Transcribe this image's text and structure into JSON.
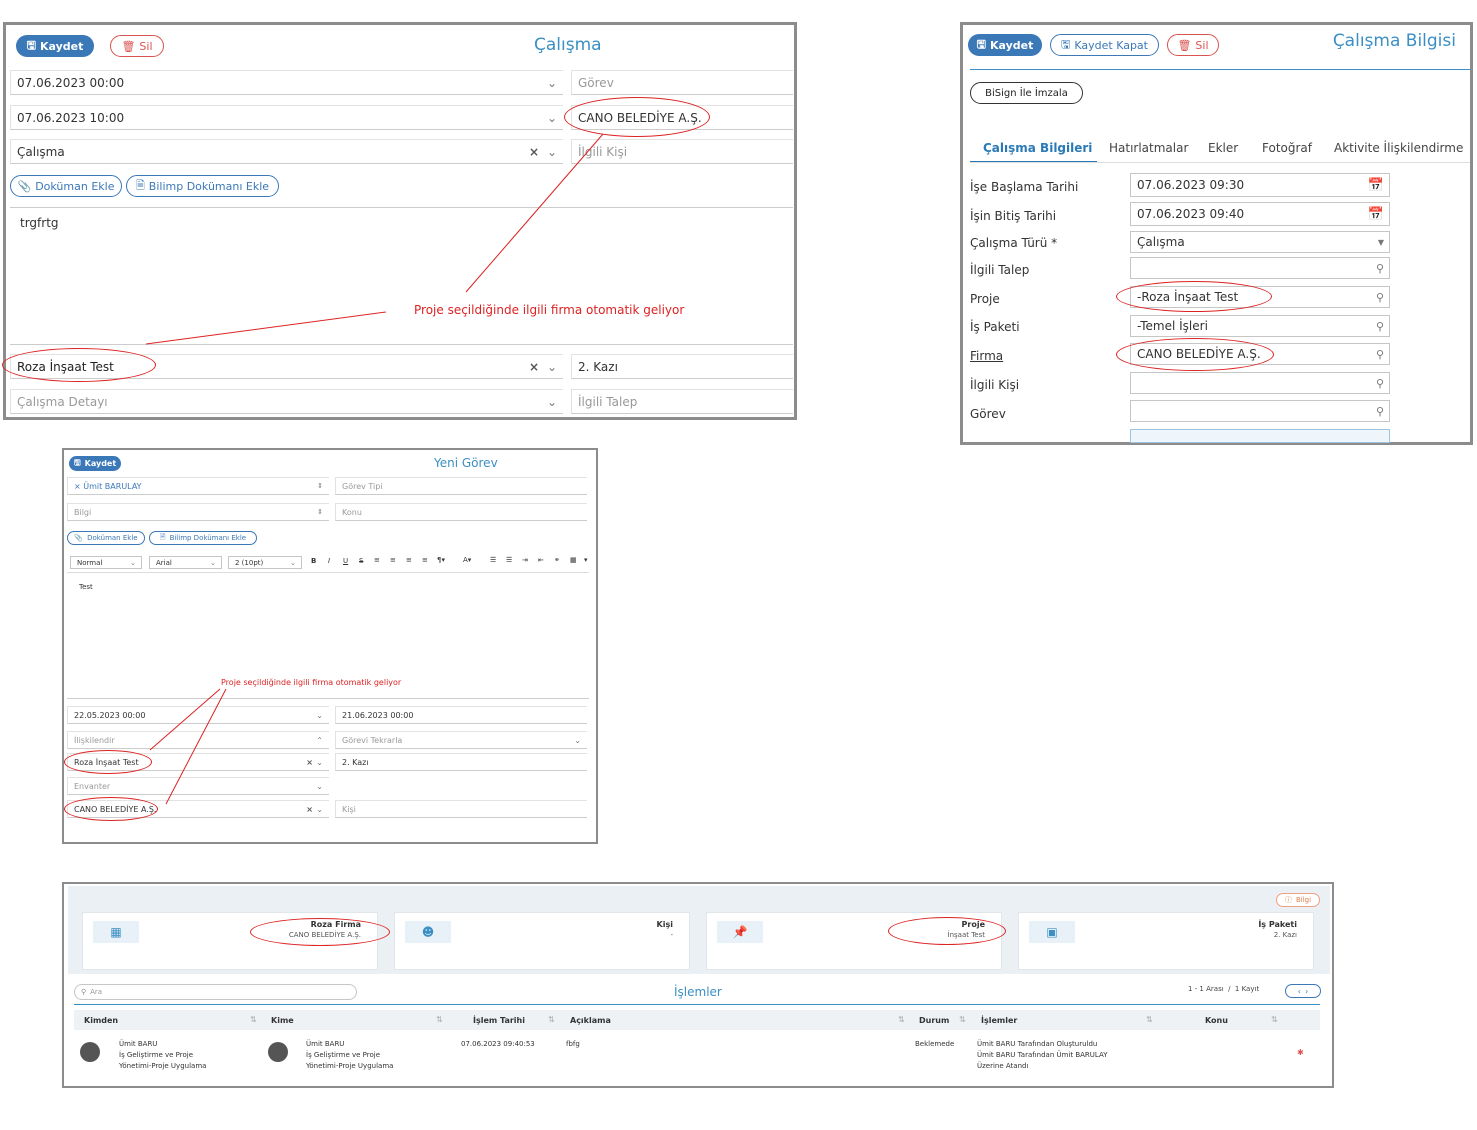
{
  "panel1": {
    "title": "Çalışma",
    "save": "Kaydet",
    "delete": "Sil",
    "start": "07.06.2023 00:00",
    "end": "07.06.2023 10:00",
    "type": "Çalışma",
    "gorev_ph": "Görev",
    "firm": "CANO BELEDİYE A.Ş.",
    "ilgili_kisi_ph": "İlgili Kişi",
    "doc_add": "Doküman Ekle",
    "bilimp_doc_add": "Bilimp Dokümanı Ekle",
    "body_text": "trgfrtg",
    "annotation": "Proje seçildiğinde ilgili firma otomatik geliyor",
    "project": "Roza İnşaat Test",
    "work_package": "2. Kazı",
    "detail_ph": "Çalışma Detayı",
    "talep_ph": "İlgili Talep"
  },
  "panel2": {
    "title": "Çalışma Bilgisi",
    "save": "Kaydet",
    "save_close": "Kaydet Kapat",
    "delete": "Sil",
    "bisign": "BiSign İle İmzala",
    "tabs": [
      "Çalışma Bilgileri",
      "Hatırlatmalar",
      "Ekler",
      "Fotoğraf",
      "Aktivite İlişkilendirme"
    ],
    "rows": [
      {
        "label": "İşe Başlama Tarihi",
        "value": "07.06.2023 09:30"
      },
      {
        "label": "İşin Bitiş Tarihi",
        "value": "07.06.2023 09:40"
      },
      {
        "label": "Çalışma Türü *",
        "value": "Çalışma"
      },
      {
        "label": "İlgili Talep",
        "value": ""
      },
      {
        "label": "Proje",
        "value": "-Roza İnşaat Test"
      },
      {
        "label": "İş Paketi",
        "value": "-Temel İşleri"
      },
      {
        "label": "Firma",
        "value": "CANO BELEDİYE A.Ş."
      },
      {
        "label": "İlgili Kişi",
        "value": ""
      },
      {
        "label": "Görev",
        "value": ""
      }
    ]
  },
  "panel3": {
    "title": "Yeni Görev",
    "save": "Kaydet",
    "assignee": "Ümit BARULAY",
    "gorev_tipi_ph": "Görev Tipi",
    "bilgi_ph": "Bilgi",
    "konu_ph": "Konu",
    "doc_add": "Doküman Ekle",
    "bilimp_doc_add": "Bilimp Dokümanı Ekle",
    "style_sel": "Normal",
    "font_sel": "Arial",
    "size_sel": "2 (10pt)",
    "body_text": "Test",
    "annotation": "Proje seçildiğinde ilgili firma otomatik geliyor",
    "start": "22.05.2023 00:00",
    "end": "21.06.2023 00:00",
    "relate_ph": "İlişkilendir",
    "repeat_ph": "Görevi Tekrarla",
    "project": "Roza İnşaat Test",
    "work_package": "2. Kazı",
    "envanter_ph": "Envanter",
    "firm": "CANO BELEDİYE A.Ş.",
    "kisi_ph": "Kişi"
  },
  "panel4": {
    "info_btn": "Bilgi",
    "cards": [
      {
        "title": "Roza Firma",
        "value": "CANO BELEDİYE A.Ş.",
        "icon": "building-icon"
      },
      {
        "title": "Kişi",
        "value": "-",
        "icon": "user-icon"
      },
      {
        "title": "Proje",
        "value": "İnşaat Test",
        "icon": "pin-icon"
      },
      {
        "title": "İş Paketi",
        "value": "2. Kazı",
        "icon": "box-icon"
      }
    ],
    "search_ph": "Ara",
    "section_title": "İşlemler",
    "paging": "1 - 1 Arası  /  1 Kayıt",
    "columns": [
      "Kimden",
      "Kime",
      "İşlem Tarihi",
      "Açıklama",
      "Durum",
      "İşlemler",
      "Konu"
    ],
    "row": {
      "from_name": "Ümit BARU",
      "from_dept1": "İş Geliştirme ve Proje",
      "from_dept2": "Yönetimi-Proje Uygulama",
      "to_name": "Ümit BARU",
      "to_dept1": "İş Geliştirme ve Proje",
      "to_dept2": "Yönetimi-Proje Uygulama",
      "date": "07.06.2023 09:40:53",
      "desc": "fbfg",
      "status": "Beklemede",
      "ops1": "Ümit BARU Tarafından Oluşturuldu",
      "ops2": "Ümit BARU Tarafından Ümit BARULAY",
      "ops3": "Üzerine Atandı"
    }
  }
}
